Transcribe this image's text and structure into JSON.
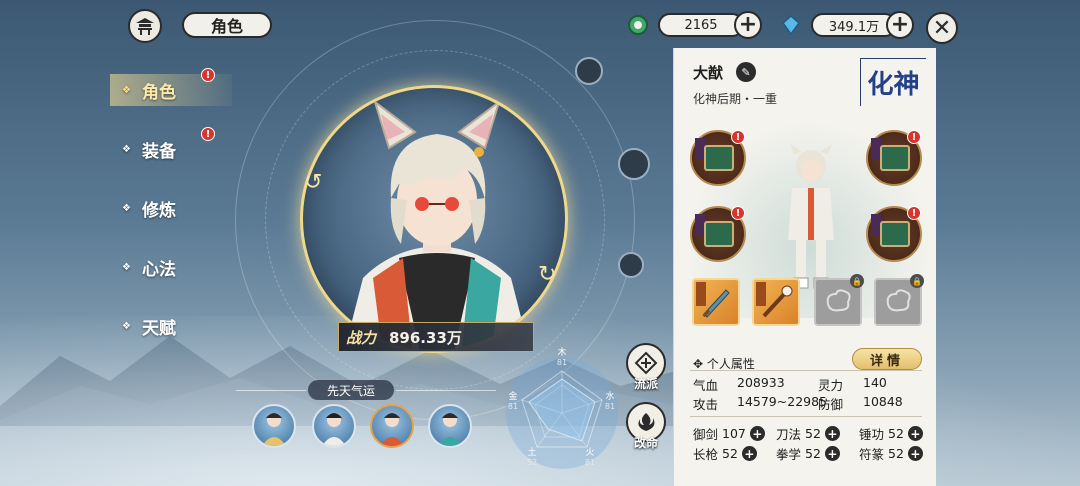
{
  "header": {
    "title": "角色"
  },
  "currency": {
    "jade": {
      "icon": "green-jade-icon",
      "value": "2165"
    },
    "spirit_stone": {
      "icon": "blue-crystal-icon",
      "value": "349.1万"
    }
  },
  "nav": {
    "items": [
      {
        "label": "角色",
        "active": true,
        "badge": "!"
      },
      {
        "label": "装备",
        "active": false,
        "badge": "!"
      },
      {
        "label": "修炼",
        "active": false,
        "badge": ""
      },
      {
        "label": "心法",
        "active": false,
        "badge": ""
      },
      {
        "label": "天赋",
        "active": false,
        "badge": ""
      }
    ]
  },
  "portrait": {
    "power_badge": "战力",
    "power_value": "896.33万"
  },
  "luck": {
    "title": "先天气运"
  },
  "radar": {
    "labels": {
      "wood": {
        "name": "木",
        "value": "81"
      },
      "water": {
        "name": "水",
        "value": "81"
      },
      "fire": {
        "name": "火",
        "value": "81"
      },
      "earth": {
        "name": "土",
        "value": "52"
      },
      "metal": {
        "name": "金",
        "value": "81"
      }
    }
  },
  "side_buttons": {
    "school": "流派",
    "fate": "改命"
  },
  "panel": {
    "name": "大猷",
    "realm_sub": "化神后期・一重",
    "realm_badge": "化神",
    "attr_heading": "个人属性",
    "detail_button": "详情",
    "attributes": {
      "hp_label": "气血",
      "hp_value": "208933",
      "sp_label": "灵力",
      "sp_value": "140",
      "atk_label": "攻击",
      "atk_value": "14579~22985",
      "def_label": "防御",
      "def_value": "10848"
    },
    "skills": [
      {
        "label": "御剑",
        "value": "107"
      },
      {
        "label": "刀法",
        "value": "52"
      },
      {
        "label": "锤功",
        "value": "52"
      },
      {
        "label": "长枪",
        "value": "52"
      },
      {
        "label": "拳学",
        "value": "52"
      },
      {
        "label": "符篆",
        "value": "52"
      }
    ]
  },
  "colors": {
    "accent_gold": "#f0d88a",
    "alert_red": "#d6342c",
    "realm_blue": "#244187"
  }
}
